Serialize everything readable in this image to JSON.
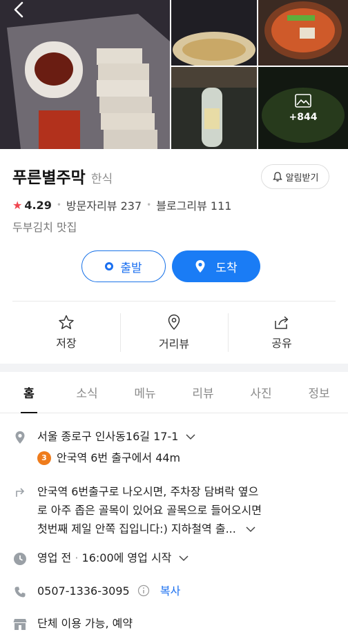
{
  "gallery": {
    "more_count": "+844"
  },
  "place": {
    "name": "푸른별주막",
    "category": "한식",
    "notify_label": "알림받기",
    "rating": "4.29",
    "visitor_reviews": "방문자리뷰 237",
    "blog_reviews": "블로그리뷰 111",
    "description": "두부김치 맛집"
  },
  "route": {
    "depart_label": "출발",
    "arrive_label": "도착"
  },
  "actions": [
    {
      "label": "저장",
      "icon": "star-outline-icon"
    },
    {
      "label": "거리뷰",
      "icon": "map-pin-outline-icon"
    },
    {
      "label": "공유",
      "icon": "share-icon"
    }
  ],
  "tabs": [
    "홈",
    "소식",
    "메뉴",
    "리뷰",
    "사진",
    "정보"
  ],
  "info": {
    "address": "서울 종로구 인사동16길 17-1",
    "subway_line": "3",
    "subway_text": "안국역 6번 출구에서 44m",
    "directions_line1": "안국역 6번출구로 나오시면, 주차장 담벼락 옆으",
    "directions_line2": "로 아주 좁은 골목이 있어요 골목으로 들어오시면",
    "directions_line3": "첫번째 제일 안쪽 집입니다:) 지하철역 출...",
    "hours_status": "영업 전",
    "hours_detail": "16:00에 영업 시작",
    "phone": "0507-1336-3095",
    "copy_label": "복사",
    "facilities": "단체 이용 가능, 예약"
  },
  "colors": {
    "accent": "#1a7cf5",
    "rating_star": "#f0464f",
    "line3": "#ef7c1c"
  }
}
